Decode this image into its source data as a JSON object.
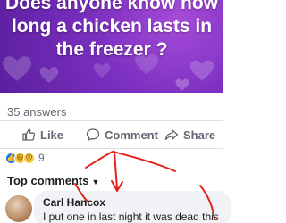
{
  "post": {
    "question": "Does anyone know how long a chicken lasts in the freezer ?",
    "answers_count": "35 answers"
  },
  "actions": {
    "like_label": "Like",
    "comment_label": "Comment",
    "share_label": "Share"
  },
  "reactions": {
    "count": "9",
    "icons": [
      "like-icon",
      "haha-icon",
      "wow-icon"
    ]
  },
  "comments": {
    "sort_label": "Top comments",
    "first": {
      "author": "Carl Hancox",
      "text": "I put one in last night it was dead this"
    }
  },
  "colors": {
    "banner": "#7a2fbf",
    "heart": "#ffffff",
    "annotation": "#e0241b",
    "comment_bubble": "#f0f2f5"
  }
}
